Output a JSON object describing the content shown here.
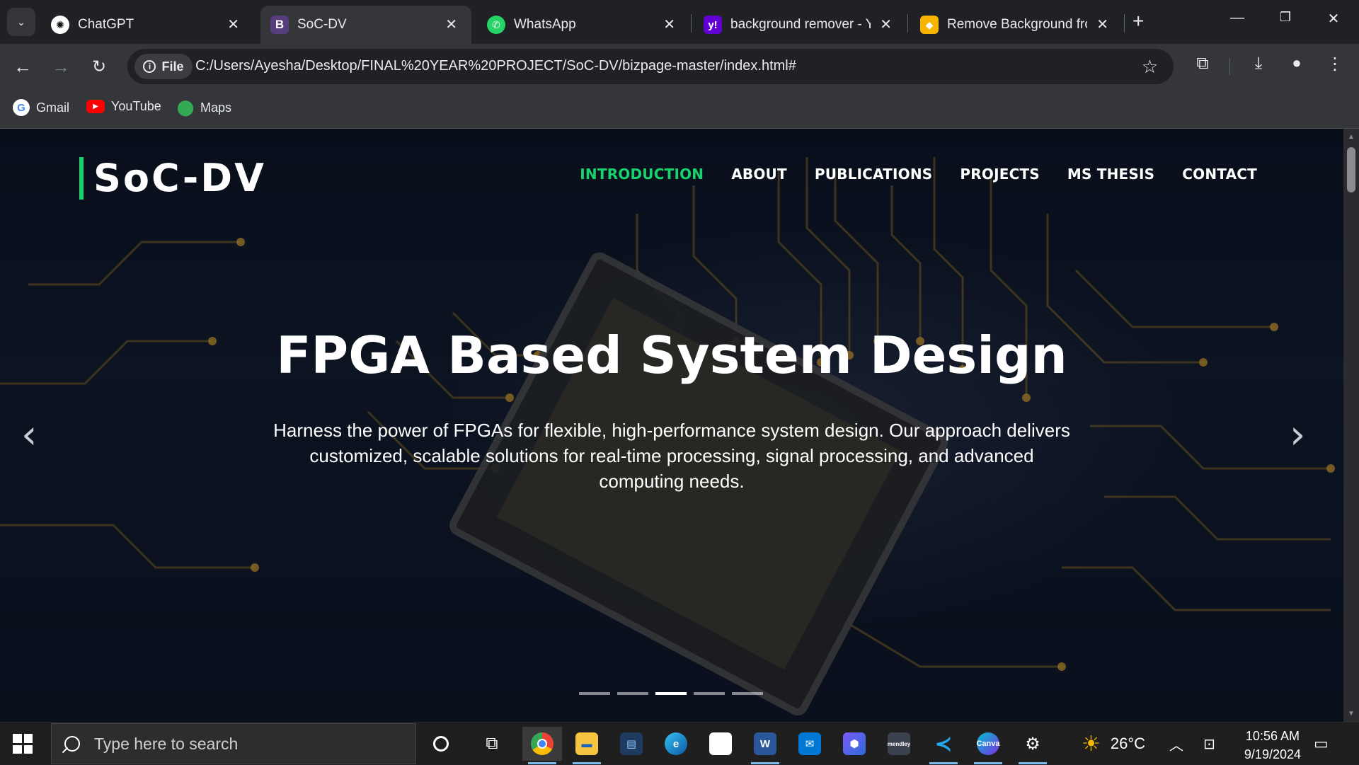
{
  "browser": {
    "tabs": [
      {
        "title": "ChatGPT",
        "icon": "chatgpt-icon",
        "active": false
      },
      {
        "title": "SoC-DV",
        "icon": "bootstrap-icon",
        "active": true
      },
      {
        "title": "WhatsApp",
        "icon": "whatsapp-icon",
        "active": false
      },
      {
        "title": "background remover - Ya",
        "icon": "yahoo-icon",
        "active": false
      },
      {
        "title": "Remove Background fron",
        "icon": "remove-bg-icon",
        "active": false
      }
    ],
    "address": {
      "chip": "File",
      "url": "C:/Users/Ayesha/Desktop/FINAL%20YEAR%20PROJECT/SoC-DV/bizpage-master/index.html#"
    },
    "bookmarks": [
      {
        "label": "Gmail",
        "icon": "google-icon"
      },
      {
        "label": "YouTube",
        "icon": "youtube-icon"
      },
      {
        "label": "Maps",
        "icon": "maps-icon"
      }
    ]
  },
  "site": {
    "logo": "SoC-DV",
    "accent_color": "#18d26e",
    "nav": [
      {
        "label": "INTRODUCTION",
        "active": true
      },
      {
        "label": "ABOUT",
        "active": false
      },
      {
        "label": "PUBLICATIONS",
        "active": false
      },
      {
        "label": "PROJECTS",
        "active": false
      },
      {
        "label": "MS THESIS",
        "active": false
      },
      {
        "label": "CONTACT",
        "active": false
      }
    ],
    "hero": {
      "title": "FPGA Based System Design",
      "text": "Harness the power of FPGAs for flexible, high-performance system design. Our approach delivers customized, scalable solutions for real-time processing, signal processing, and advanced computing needs.",
      "prev_glyph": "‹",
      "next_glyph": "›",
      "slide_count": 5,
      "active_slide": 3
    }
  },
  "taskbar": {
    "search_placeholder": "Type here to search",
    "weather": "26°C",
    "time": "10:56 AM",
    "date": "9/19/2024"
  }
}
